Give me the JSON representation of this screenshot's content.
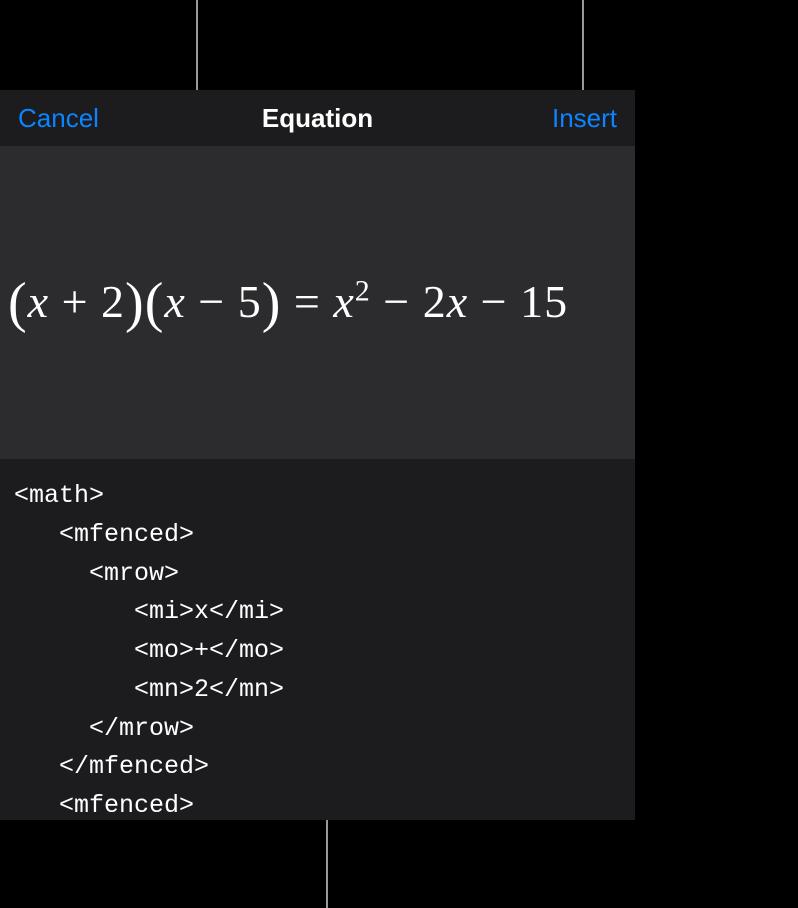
{
  "header": {
    "cancel_label": "Cancel",
    "title": "Equation",
    "insert_label": "Insert"
  },
  "equation": {
    "lhs_term1_var": "x",
    "lhs_term1_op": "+",
    "lhs_term1_num": "2",
    "lhs_term2_var": "x",
    "lhs_term2_op": "−",
    "lhs_term2_num": "5",
    "equals": "=",
    "rhs_var": "x",
    "rhs_exp": "2",
    "rhs_op1": "−",
    "rhs_coef": "2",
    "rhs_var2": "x",
    "rhs_op2": "−",
    "rhs_const": "15"
  },
  "code": "<math>\n   <mfenced>\n     <mrow>\n        <mi>x</mi>\n        <mo>+</mo>\n        <mn>2</mn>\n     </mrow>\n   </mfenced>\n   <mfenced>\n     <mrow>"
}
